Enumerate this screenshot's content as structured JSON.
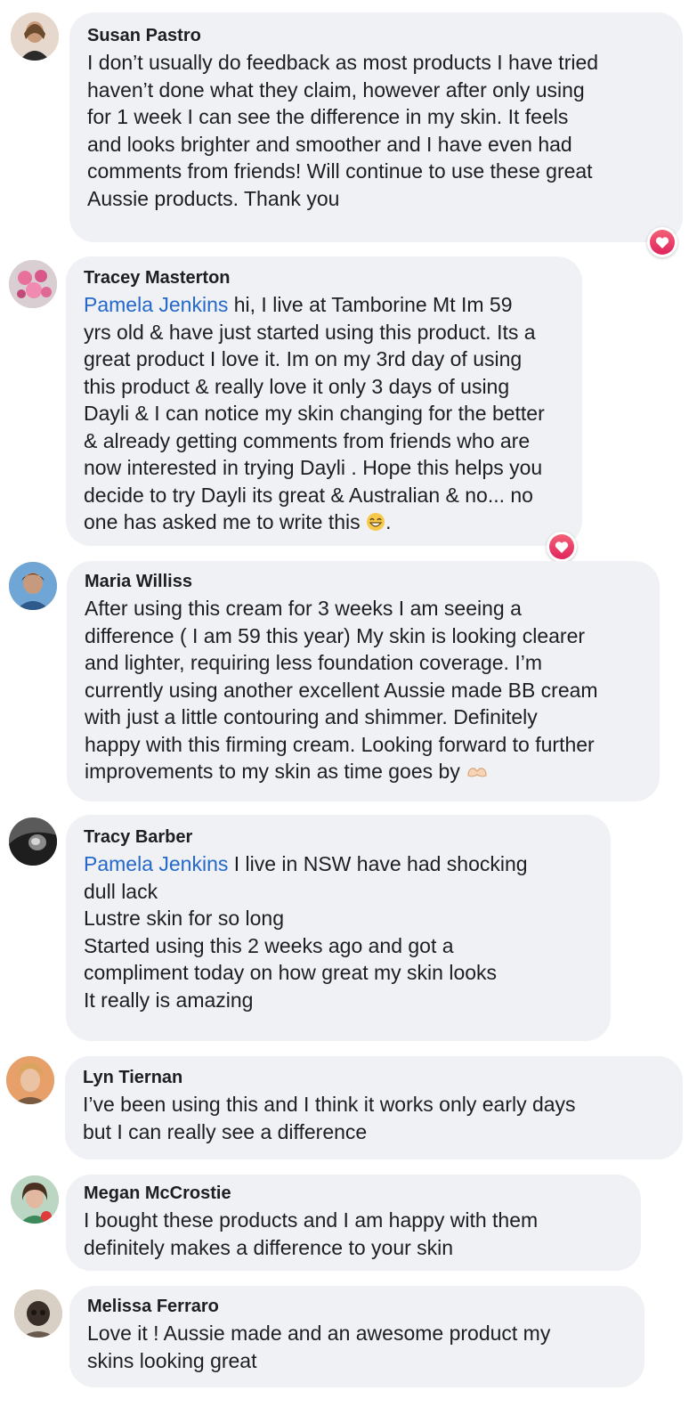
{
  "colors": {
    "bubble": "#eff1f5",
    "mention": "#2468c9",
    "heart": "#e0245e",
    "text": "#1c1e21"
  },
  "comments": [
    {
      "name": "Susan Pastro",
      "text": "I don’t usually do feedback as most products I have tried\nhaven’t done what they claim, however after only using\nfor 1 week I can see the difference in my skin. It feels\nand looks brighter and smoother and I have even had\ncomments from friends! Will continue to use these great\nAussie products. Thank you",
      "reaction": "heart-icon"
    },
    {
      "name": "Tracey Masterton",
      "mention": "Pamela Jenkins",
      "text": " hi, I live at Tamborine Mt Im 59\nyrs old & have just started using this product. Its a\ngreat product I love it. Im on my 3rd day of using\nthis product & really love it only 3 days of using\nDayli & I can notice my skin changing for the better\n& already getting comments from friends who are\nnow interested in trying Dayli . Hope this helps you\ndecide to try Dayli its great & Australian & no... no\none has asked me to write this ",
      "text_end": ".",
      "emoji": "grinning-face-emoji",
      "reaction": "heart-icon"
    },
    {
      "name": "Maria Williss",
      "text": "After using this cream for 3 weeks I am seeing a\ndifference ( I am 59 this year) My skin is looking clearer\nand lighter, requiring less foundation coverage. I’m\ncurrently using another excellent Aussie made BB cream\nwith just a little contouring and shimmer. Definitely\nhappy with this firming cream. Looking forward to further\nimprovements to my skin as time goes by ",
      "emoji": "heart-hands-emoji"
    },
    {
      "name": "Tracy Barber",
      "mention": "Pamela Jenkins",
      "text": " I live in NSW have had shocking\ndull lack\nLustre skin for so long\nStarted using this 2 weeks ago and got a\ncompliment today on how great my skin looks\nIt really is amazing"
    },
    {
      "name": "Lyn Tiernan",
      "text": "I’ve been using this and I think it works only early days\nbut I can really see a difference"
    },
    {
      "name": "Megan McCrostie",
      "text": "I bought these products and I am happy with them\ndefinitely makes a difference to your skin"
    },
    {
      "name": "Melissa Ferraro",
      "text": "Love it ! Aussie made and an awesome product my\nskins looking great"
    }
  ]
}
